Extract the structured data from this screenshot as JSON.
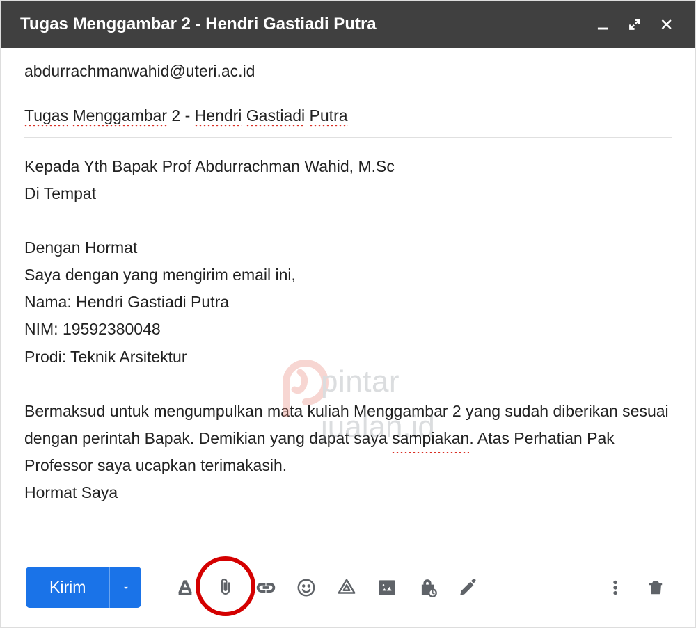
{
  "header": {
    "title": "Tugas Menggambar 2 - Hendri Gastiadi Putra"
  },
  "recipient": "abdurrachmanwahid@uteri.ac.id",
  "subject": {
    "segments": [
      {
        "t": "Tugas",
        "err": true
      },
      {
        "t": " ",
        "err": false
      },
      {
        "t": "Menggambar",
        "err": true
      },
      {
        "t": " 2 - ",
        "err": false
      },
      {
        "t": "Hendri",
        "err": true
      },
      {
        "t": " ",
        "err": false
      },
      {
        "t": "Gastiadi",
        "err": true
      },
      {
        "t": " ",
        "err": false
      },
      {
        "t": "Putra",
        "err": true
      }
    ]
  },
  "body": {
    "line1": "Kepada Yth Bapak Prof Abdurrachman Wahid, M.Sc",
    "line2": "Di Tempat",
    "line3": "Dengan Hormat",
    "line4": "Saya dengan yang mengirim email ini,",
    "line5": "Nama: Hendri Gastiadi Putra",
    "line6": "NIM: 19592380048",
    "line7": "Prodi: Teknik Arsitektur",
    "line8a": "Bermaksud untuk mengumpulkan mata kuliah Menggambar 2 yang sudah diberikan sesuai dengan perintah Bapak. Demikian yang dapat saya ",
    "line8err": "sampiakan",
    "line8b": ". Atas Perhatian Pak Professor saya ucapkan terimakasih.",
    "line9": "Hormat Saya"
  },
  "toolbar": {
    "send": "Kirim"
  },
  "watermark": {
    "line1": "pintar",
    "line2": "jualan.id"
  }
}
